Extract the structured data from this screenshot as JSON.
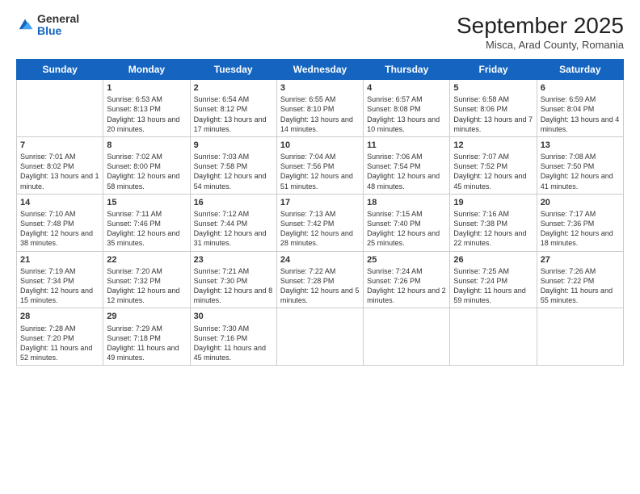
{
  "logo": {
    "general": "General",
    "blue": "Blue"
  },
  "header": {
    "title": "September 2025",
    "subtitle": "Misca, Arad County, Romania"
  },
  "days_of_week": [
    "Sunday",
    "Monday",
    "Tuesday",
    "Wednesday",
    "Thursday",
    "Friday",
    "Saturday"
  ],
  "weeks": [
    [
      {
        "day": "",
        "sunrise": "",
        "sunset": "",
        "daylight": ""
      },
      {
        "day": "1",
        "sunrise": "Sunrise: 6:53 AM",
        "sunset": "Sunset: 8:13 PM",
        "daylight": "Daylight: 13 hours and 20 minutes."
      },
      {
        "day": "2",
        "sunrise": "Sunrise: 6:54 AM",
        "sunset": "Sunset: 8:12 PM",
        "daylight": "Daylight: 13 hours and 17 minutes."
      },
      {
        "day": "3",
        "sunrise": "Sunrise: 6:55 AM",
        "sunset": "Sunset: 8:10 PM",
        "daylight": "Daylight: 13 hours and 14 minutes."
      },
      {
        "day": "4",
        "sunrise": "Sunrise: 6:57 AM",
        "sunset": "Sunset: 8:08 PM",
        "daylight": "Daylight: 13 hours and 10 minutes."
      },
      {
        "day": "5",
        "sunrise": "Sunrise: 6:58 AM",
        "sunset": "Sunset: 8:06 PM",
        "daylight": "Daylight: 13 hours and 7 minutes."
      },
      {
        "day": "6",
        "sunrise": "Sunrise: 6:59 AM",
        "sunset": "Sunset: 8:04 PM",
        "daylight": "Daylight: 13 hours and 4 minutes."
      }
    ],
    [
      {
        "day": "7",
        "sunrise": "Sunrise: 7:01 AM",
        "sunset": "Sunset: 8:02 PM",
        "daylight": "Daylight: 13 hours and 1 minute."
      },
      {
        "day": "8",
        "sunrise": "Sunrise: 7:02 AM",
        "sunset": "Sunset: 8:00 PM",
        "daylight": "Daylight: 12 hours and 58 minutes."
      },
      {
        "day": "9",
        "sunrise": "Sunrise: 7:03 AM",
        "sunset": "Sunset: 7:58 PM",
        "daylight": "Daylight: 12 hours and 54 minutes."
      },
      {
        "day": "10",
        "sunrise": "Sunrise: 7:04 AM",
        "sunset": "Sunset: 7:56 PM",
        "daylight": "Daylight: 12 hours and 51 minutes."
      },
      {
        "day": "11",
        "sunrise": "Sunrise: 7:06 AM",
        "sunset": "Sunset: 7:54 PM",
        "daylight": "Daylight: 12 hours and 48 minutes."
      },
      {
        "day": "12",
        "sunrise": "Sunrise: 7:07 AM",
        "sunset": "Sunset: 7:52 PM",
        "daylight": "Daylight: 12 hours and 45 minutes."
      },
      {
        "day": "13",
        "sunrise": "Sunrise: 7:08 AM",
        "sunset": "Sunset: 7:50 PM",
        "daylight": "Daylight: 12 hours and 41 minutes."
      }
    ],
    [
      {
        "day": "14",
        "sunrise": "Sunrise: 7:10 AM",
        "sunset": "Sunset: 7:48 PM",
        "daylight": "Daylight: 12 hours and 38 minutes."
      },
      {
        "day": "15",
        "sunrise": "Sunrise: 7:11 AM",
        "sunset": "Sunset: 7:46 PM",
        "daylight": "Daylight: 12 hours and 35 minutes."
      },
      {
        "day": "16",
        "sunrise": "Sunrise: 7:12 AM",
        "sunset": "Sunset: 7:44 PM",
        "daylight": "Daylight: 12 hours and 31 minutes."
      },
      {
        "day": "17",
        "sunrise": "Sunrise: 7:13 AM",
        "sunset": "Sunset: 7:42 PM",
        "daylight": "Daylight: 12 hours and 28 minutes."
      },
      {
        "day": "18",
        "sunrise": "Sunrise: 7:15 AM",
        "sunset": "Sunset: 7:40 PM",
        "daylight": "Daylight: 12 hours and 25 minutes."
      },
      {
        "day": "19",
        "sunrise": "Sunrise: 7:16 AM",
        "sunset": "Sunset: 7:38 PM",
        "daylight": "Daylight: 12 hours and 22 minutes."
      },
      {
        "day": "20",
        "sunrise": "Sunrise: 7:17 AM",
        "sunset": "Sunset: 7:36 PM",
        "daylight": "Daylight: 12 hours and 18 minutes."
      }
    ],
    [
      {
        "day": "21",
        "sunrise": "Sunrise: 7:19 AM",
        "sunset": "Sunset: 7:34 PM",
        "daylight": "Daylight: 12 hours and 15 minutes."
      },
      {
        "day": "22",
        "sunrise": "Sunrise: 7:20 AM",
        "sunset": "Sunset: 7:32 PM",
        "daylight": "Daylight: 12 hours and 12 minutes."
      },
      {
        "day": "23",
        "sunrise": "Sunrise: 7:21 AM",
        "sunset": "Sunset: 7:30 PM",
        "daylight": "Daylight: 12 hours and 8 minutes."
      },
      {
        "day": "24",
        "sunrise": "Sunrise: 7:22 AM",
        "sunset": "Sunset: 7:28 PM",
        "daylight": "Daylight: 12 hours and 5 minutes."
      },
      {
        "day": "25",
        "sunrise": "Sunrise: 7:24 AM",
        "sunset": "Sunset: 7:26 PM",
        "daylight": "Daylight: 12 hours and 2 minutes."
      },
      {
        "day": "26",
        "sunrise": "Sunrise: 7:25 AM",
        "sunset": "Sunset: 7:24 PM",
        "daylight": "Daylight: 11 hours and 59 minutes."
      },
      {
        "day": "27",
        "sunrise": "Sunrise: 7:26 AM",
        "sunset": "Sunset: 7:22 PM",
        "daylight": "Daylight: 11 hours and 55 minutes."
      }
    ],
    [
      {
        "day": "28",
        "sunrise": "Sunrise: 7:28 AM",
        "sunset": "Sunset: 7:20 PM",
        "daylight": "Daylight: 11 hours and 52 minutes."
      },
      {
        "day": "29",
        "sunrise": "Sunrise: 7:29 AM",
        "sunset": "Sunset: 7:18 PM",
        "daylight": "Daylight: 11 hours and 49 minutes."
      },
      {
        "day": "30",
        "sunrise": "Sunrise: 7:30 AM",
        "sunset": "Sunset: 7:16 PM",
        "daylight": "Daylight: 11 hours and 45 minutes."
      },
      {
        "day": "",
        "sunrise": "",
        "sunset": "",
        "daylight": ""
      },
      {
        "day": "",
        "sunrise": "",
        "sunset": "",
        "daylight": ""
      },
      {
        "day": "",
        "sunrise": "",
        "sunset": "",
        "daylight": ""
      },
      {
        "day": "",
        "sunrise": "",
        "sunset": "",
        "daylight": ""
      }
    ]
  ]
}
